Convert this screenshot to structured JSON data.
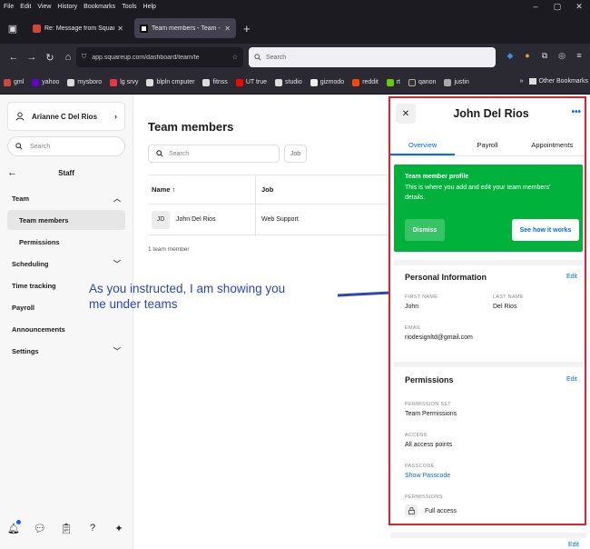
{
  "browser": {
    "menu": [
      "File",
      "Edit",
      "View",
      "History",
      "Bookmarks",
      "Tools",
      "Help"
    ],
    "tabs": [
      {
        "title": "Re: Message from Square Suppo",
        "active": false
      },
      {
        "title": "Team members - Team - Staff | Sq",
        "active": true
      }
    ],
    "url": "app.squareup.com/dashboard/team/te",
    "search_placeholder": "Search",
    "bookmarks": [
      "gml",
      "yahoo",
      "mysboro",
      "lg srvy",
      "blpln cmputer",
      "fitnss",
      "UT true",
      "studio",
      "gizmodo",
      "reddit",
      "rt",
      "qanon",
      "justin"
    ],
    "other_bookmarks": "Other Bookmarks"
  },
  "sidebar": {
    "account_name": "Arianne C Del Rios",
    "search_placeholder": "Search",
    "section": "Staff",
    "items": [
      {
        "label": "Team",
        "expanded": true
      },
      {
        "label": "Team members",
        "selected": true
      },
      {
        "label": "Permissions"
      },
      {
        "label": "Scheduling"
      },
      {
        "label": "Time tracking"
      },
      {
        "label": "Payroll"
      },
      {
        "label": "Announcements"
      },
      {
        "label": "Settings"
      }
    ]
  },
  "main": {
    "title": "Team members",
    "search_placeholder": "Search",
    "filter_label": "Job",
    "columns": [
      "Name ↑",
      "Job"
    ],
    "rows": [
      {
        "initials": "JD",
        "name": "John Del Rios",
        "job": "Web Support"
      }
    ],
    "count": "1 team member"
  },
  "annotation": {
    "line1": "As you instructed, I am showing you",
    "line2": "me under teams",
    "color": "#2748b5"
  },
  "panel": {
    "name": "John Del Rios",
    "more": "•••",
    "tabs": [
      "Overview",
      "Payroll",
      "Appointments"
    ],
    "promo": {
      "heading": "Team member profile",
      "desc": "This is where you add and edit your team members' details.",
      "dismiss": "Dismiss",
      "cta": "See how it works"
    },
    "personal": {
      "title": "Personal Information",
      "edit": "Edit",
      "first_name_label": "FIRST NAME",
      "first_name": "John",
      "last_name_label": "LAST NAME",
      "last_name": "Del Rios",
      "email_label": "EMAIL",
      "email": "riodesignltd@gmail.com"
    },
    "permissions": {
      "title": "Permissions",
      "edit": "Edit",
      "set_label": "PERMISSION SET",
      "set": "Team Permissions",
      "access_label": "ACCESS",
      "access": "All access points",
      "passcode_label": "PASSCODE",
      "passcode": "Show Passcode",
      "perm_label": "PERMISSIONS",
      "perm": "Full access"
    },
    "bottom_edit": "Edit"
  },
  "colors": {
    "accent": "#006aff",
    "promo": "#00b23b",
    "highlight_border": "#e4202c"
  }
}
